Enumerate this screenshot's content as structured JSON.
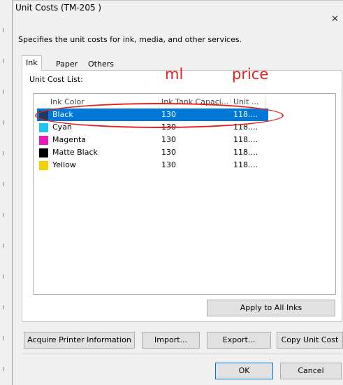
{
  "window": {
    "title": "Unit Costs (TM-205 )",
    "close_icon": "close-icon",
    "description": "Specifies the unit costs for ink, media, and other services."
  },
  "tabs": [
    {
      "label": "Ink",
      "active": true
    },
    {
      "label": "Paper",
      "active": false
    },
    {
      "label": "Others",
      "active": false
    }
  ],
  "list": {
    "label": "Unit Cost List:",
    "columns": [
      "Ink Color",
      "Ink Tank Capaci...",
      "Unit ..."
    ],
    "rows": [
      {
        "name": "Black",
        "capacity": "130",
        "price": "118....",
        "color": "#1f3a5f",
        "selected": true
      },
      {
        "name": "Cyan",
        "capacity": "130",
        "price": "118....",
        "color": "#1cc6f0",
        "selected": false
      },
      {
        "name": "Magenta",
        "capacity": "130",
        "price": "118....",
        "color": "#e81ab8",
        "selected": false
      },
      {
        "name": "Matte Black",
        "capacity": "130",
        "price": "118....",
        "color": "#000000",
        "selected": false
      },
      {
        "name": "Yellow",
        "capacity": "130",
        "price": "118....",
        "color": "#f5d000",
        "selected": false
      }
    ]
  },
  "annotations": {
    "ml_label": "ml",
    "price_label": "price",
    "color": "#e8211d"
  },
  "buttons": {
    "apply_all": "Apply to All Inks",
    "acquire": "Acquire Printer Information",
    "import": "Import...",
    "export": "Export...",
    "copy": "Copy Unit Cost",
    "ok": "OK",
    "cancel": "Cancel"
  },
  "colors": {
    "selection": "#0078d7",
    "dialog_bg": "#f0f0f0"
  }
}
